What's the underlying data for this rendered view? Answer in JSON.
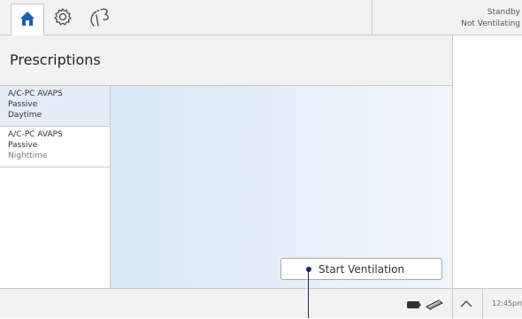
{
  "status": {
    "line1": "Standby",
    "line2": "Not Ventilating"
  },
  "title": "Prescriptions",
  "prescriptions": [
    {
      "mode": "A/C-PC AVAPS",
      "circuit": "Passive",
      "name": "Daytime",
      "selected": true
    },
    {
      "mode": "A/C-PC AVAPS",
      "circuit": "Passive",
      "name": "Nighttime",
      "selected": false
    }
  ],
  "start_button": "Start Ventilation",
  "clock": "12:45pm",
  "icons": {
    "home": "home-icon",
    "settings": "gear-icon",
    "therapy": "leaf-icon",
    "battery": "battery-icon",
    "power": "plug-icon",
    "expand": "chevron-up-icon"
  },
  "colors": {
    "accent": "#1a5fb4",
    "selected_row": "#e4edf8",
    "detail_bg": "#d9e8f7"
  }
}
